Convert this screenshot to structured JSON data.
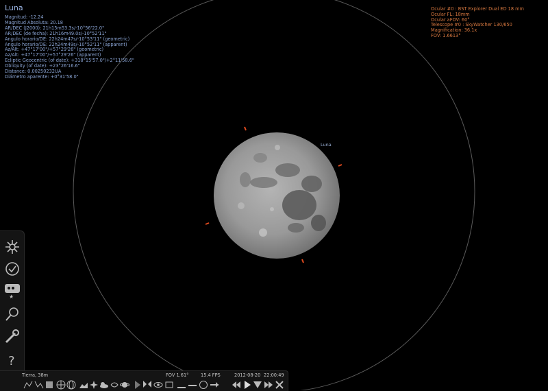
{
  "object": {
    "name": "Luna",
    "info_lines": [
      "Magnitud: -12.24",
      "Magnitud Absoluta: 20.18",
      "AR/DEC (J2000): 21h15m53.3s/-10°56'22.0\"",
      "AR/DEC (de fecha): 21h16m49.0s/-10°52'11\"",
      "Angulo horario/DE: 22h24m47s/-10°53'11\" (geometric)",
      "Angulo horario/DE: 22h24m49s/-10°52'11\" (apparent)",
      "Az/Alt: +47°17'00\"/+57°29'26\" (geometric)",
      "Az/Alt: +47°17'00\"/+57°29'26\" (apparent)",
      "Ecliptic Geocentric (of date): +318°15'57.0\"/+2°11'58.6\"",
      "Obliquity (of date): +23°26'16.6\"",
      "Distance: 0.00250232UA",
      "Diámetro aparente: +0°31'58.0\""
    ],
    "label": "Luna"
  },
  "ocular": {
    "lines": [
      "Ocular #0 : BST Explorer Dual ED 18 mm",
      "Ocular FL: 18mm",
      "Ocular aFOV: 60°",
      "Telescope #0 : SkyWatcher 130/650",
      "Magnification: 36.1x",
      "FOV: 1.6613°"
    ],
    "color": "#d5773f"
  },
  "sidebar": {
    "buttons": [
      {
        "name": "sky-and-viewing-options-icon"
      },
      {
        "name": "date-time-icon"
      },
      {
        "name": "location-icon"
      },
      {
        "name": "search-icon"
      },
      {
        "name": "configuration-icon"
      },
      {
        "name": "help-icon"
      }
    ]
  },
  "bottombar": {
    "location": "Tierra, 38m",
    "fov": "FOV 1.61°",
    "fps": "15.4 FPS",
    "date": "2012-08-20",
    "time": "22:00:49"
  }
}
